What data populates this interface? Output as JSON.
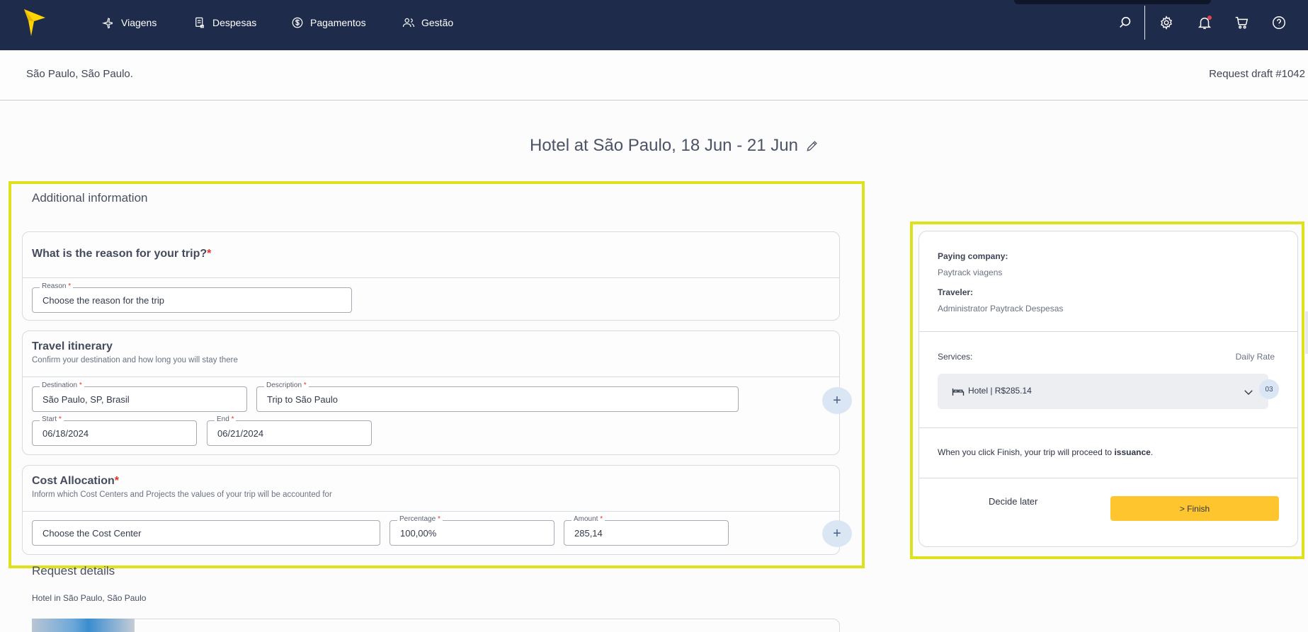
{
  "nav": {
    "items": [
      {
        "label": "Viagens",
        "icon": "plane-icon"
      },
      {
        "label": "Despesas",
        "icon": "receipt-icon"
      },
      {
        "label": "Pagamentos",
        "icon": "dollar-circle-icon"
      },
      {
        "label": "Gestão",
        "icon": "users-icon"
      }
    ],
    "right_icons": [
      "search-icon",
      "gear-icon",
      "bell-icon",
      "cart-icon",
      "help-icon"
    ],
    "brand_color": "#1f2b4b",
    "logo_color": "#ffd400"
  },
  "subheader": {
    "location": "São Paulo, São Paulo.",
    "draft": "Request draft #1042"
  },
  "page": {
    "title": "Hotel at São Paulo, 18 Jun - 21 Jun"
  },
  "additional": {
    "heading": "Additional information",
    "reason": {
      "title": "What is the reason for your trip?",
      "required_mark": "*",
      "field_label": "Reason",
      "field_placeholder": "Choose the reason for the trip"
    },
    "itinerary": {
      "title": "Travel itinerary",
      "subtitle": "Confirm your destination and how long you will stay there",
      "destination_label": "Destination",
      "destination_value": "São Paulo, SP, Brasil",
      "description_label": "Description",
      "description_value": "Trip to São Paulo",
      "start_label": "Start",
      "start_value": "06/18/2024",
      "end_label": "End",
      "end_value": "06/21/2024",
      "add_label": "+"
    },
    "cost": {
      "title": "Cost Allocation",
      "required_mark": "*",
      "subtitle": "Inform which Cost Centers and Projects the values of your trip will be accounted for",
      "cost_center_placeholder": "Choose the Cost Center",
      "percentage_label": "Percentage",
      "percentage_value": "100,00%",
      "amount_label": "Amount",
      "amount_value": "285,14",
      "add_label": "+"
    },
    "required_asterisk": "*"
  },
  "details": {
    "title": "Request details",
    "subtitle": "Hotel in São Paulo, São Paulo"
  },
  "summary": {
    "paying_company_label": "Paying company:",
    "paying_company_value": "Paytrack viagens",
    "traveler_label": "Traveler:",
    "traveler_value": "Administrator Paytrack Despesas",
    "services_label": "Services:",
    "daily_rate_label": "Daily Rate",
    "service_item": "Hotel | R$285.14",
    "service_count": "03",
    "finish_note_prefix": "When you click Finish, your trip will proceed to",
    "finish_note_bold": "issuance",
    "finish_note_suffix": ".",
    "decide_later": "Decide later",
    "finish_button": "> Finish",
    "finish_color": "#ffc52e"
  },
  "highlight_color": "#dfe11d"
}
